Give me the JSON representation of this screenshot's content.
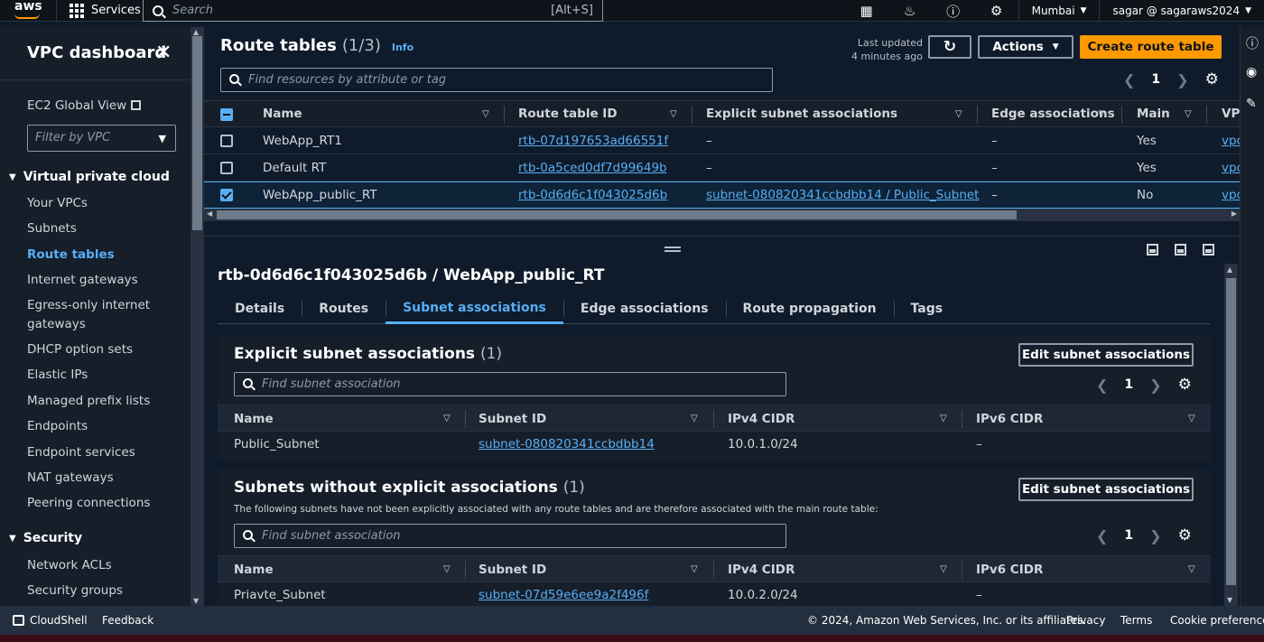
{
  "topnav": {
    "logo": "aws",
    "services_label": "Services",
    "search_placeholder": "Search",
    "search_shortcut": "[Alt+S]",
    "region": "Mumbai",
    "account": "sagar @ sagaraws2024",
    "icons": [
      "cloudshell-icon",
      "bell-icon",
      "help-icon",
      "gear-icon"
    ]
  },
  "sidebar": {
    "title": "VPC dashboard",
    "ec2_global_view": "EC2 Global View",
    "filter_placeholder": "Filter by VPC",
    "section_vpc": "Virtual private cloud",
    "items": [
      {
        "label": "Your VPCs"
      },
      {
        "label": "Subnets"
      },
      {
        "label": "Route tables",
        "active": true
      },
      {
        "label": "Internet gateways"
      },
      {
        "label": "Egress-only internet"
      },
      {
        "label": "gateways"
      },
      {
        "label": "DHCP option sets"
      },
      {
        "label": "Elastic IPs"
      },
      {
        "label": "Managed prefix lists"
      },
      {
        "label": "Endpoints"
      },
      {
        "label": "Endpoint services"
      },
      {
        "label": "NAT gateways"
      },
      {
        "label": "Peering connections"
      }
    ],
    "section_security": "Security",
    "security_items": [
      {
        "label": "Network ACLs"
      },
      {
        "label": "Security groups"
      }
    ]
  },
  "route_tables": {
    "title": "Route tables",
    "count": "(1/3)",
    "info": "Info",
    "last_updated_line1": "Last updated",
    "last_updated_line2": "4 minutes ago",
    "actions_label": "Actions",
    "create_label": "Create route table",
    "search_placeholder": "Find resources by attribute or tag",
    "page": "1",
    "columns": [
      "Name",
      "Route table ID",
      "Explicit subnet associations",
      "Edge associations",
      "Main",
      "VP"
    ],
    "rows": [
      {
        "name": "WebApp_RT1",
        "id": "rtb-07d197653ad66551f",
        "explicit": "–",
        "edge": "–",
        "main": "Yes",
        "vpc": "vpc",
        "selected": false
      },
      {
        "name": "Default RT",
        "id": "rtb-0a5ced0df7d99649b",
        "explicit": "–",
        "edge": "–",
        "main": "Yes",
        "vpc": "vpc",
        "selected": false
      },
      {
        "name": "WebApp_public_RT",
        "id": "rtb-0d6d6c1f043025d6b",
        "explicit": "subnet-080820341ccbdbb14 / Public_Subnet",
        "edge": "–",
        "main": "No",
        "vpc": "vpc",
        "selected": true
      }
    ]
  },
  "detail": {
    "title": "rtb-0d6d6c1f043025d6b / WebApp_public_RT",
    "tabs": [
      "Details",
      "Routes",
      "Subnet associations",
      "Edge associations",
      "Route propagation",
      "Tags"
    ],
    "active_tab": "Subnet associations",
    "explicit": {
      "title": "Explicit subnet associations",
      "count": "(1)",
      "edit_label": "Edit subnet associations",
      "search_placeholder": "Find subnet association",
      "page": "1",
      "columns": [
        "Name",
        "Subnet ID",
        "IPv4 CIDR",
        "IPv6 CIDR"
      ],
      "rows": [
        {
          "name": "Public_Subnet",
          "subnet_id": "subnet-080820341ccbdbb14",
          "ipv4": "10.0.1.0/24",
          "ipv6": "–"
        }
      ]
    },
    "without": {
      "title": "Subnets without explicit associations",
      "count": "(1)",
      "description": "The following subnets have not been explicitly associated with any route tables and are therefore associated with the main route table:",
      "edit_label": "Edit subnet associations",
      "search_placeholder": "Find subnet association",
      "page": "1",
      "columns": [
        "Name",
        "Subnet ID",
        "IPv4 CIDR",
        "IPv6 CIDR"
      ],
      "rows": [
        {
          "name": "Priavte_Subnet",
          "subnet_id": "subnet-07d59e6ee9a2f496f",
          "ipv4": "10.0.2.0/24",
          "ipv6": "–"
        }
      ]
    }
  },
  "footer": {
    "cloudshell": "CloudShell",
    "feedback": "Feedback",
    "copyright": "© 2024, Amazon Web Services, Inc. or its affiliates.",
    "privacy": "Privacy",
    "terms": "Terms",
    "cookies": "Cookie preferences"
  },
  "colors": {
    "accent_orange": "#ff9900",
    "link_blue": "#58aef5",
    "background": "#0f1b2a"
  }
}
